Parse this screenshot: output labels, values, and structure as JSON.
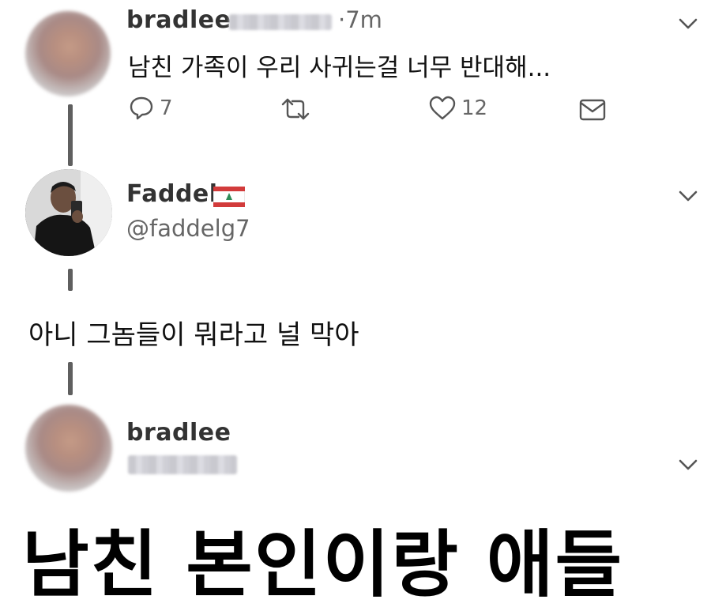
{
  "tweets": [
    {
      "username": "bradlee",
      "time": "·7m",
      "text": "남친 가족이 우리 사귀는걸 너무 반대해...",
      "actions": {
        "reply_count": "7",
        "like_count": "12"
      }
    },
    {
      "username": "Faddel",
      "flag": "🇱🇧",
      "handle": "@faddelg7",
      "text": "아니 그놈들이 뭐라고 널 막아"
    },
    {
      "username": "bradlee"
    }
  ],
  "caption": "남친 본인이랑 애들",
  "icons": [
    "reply-icon",
    "retweet-icon",
    "like-icon",
    "share-icon",
    "chevron-down-icon",
    "lebanon-flag-icon"
  ]
}
